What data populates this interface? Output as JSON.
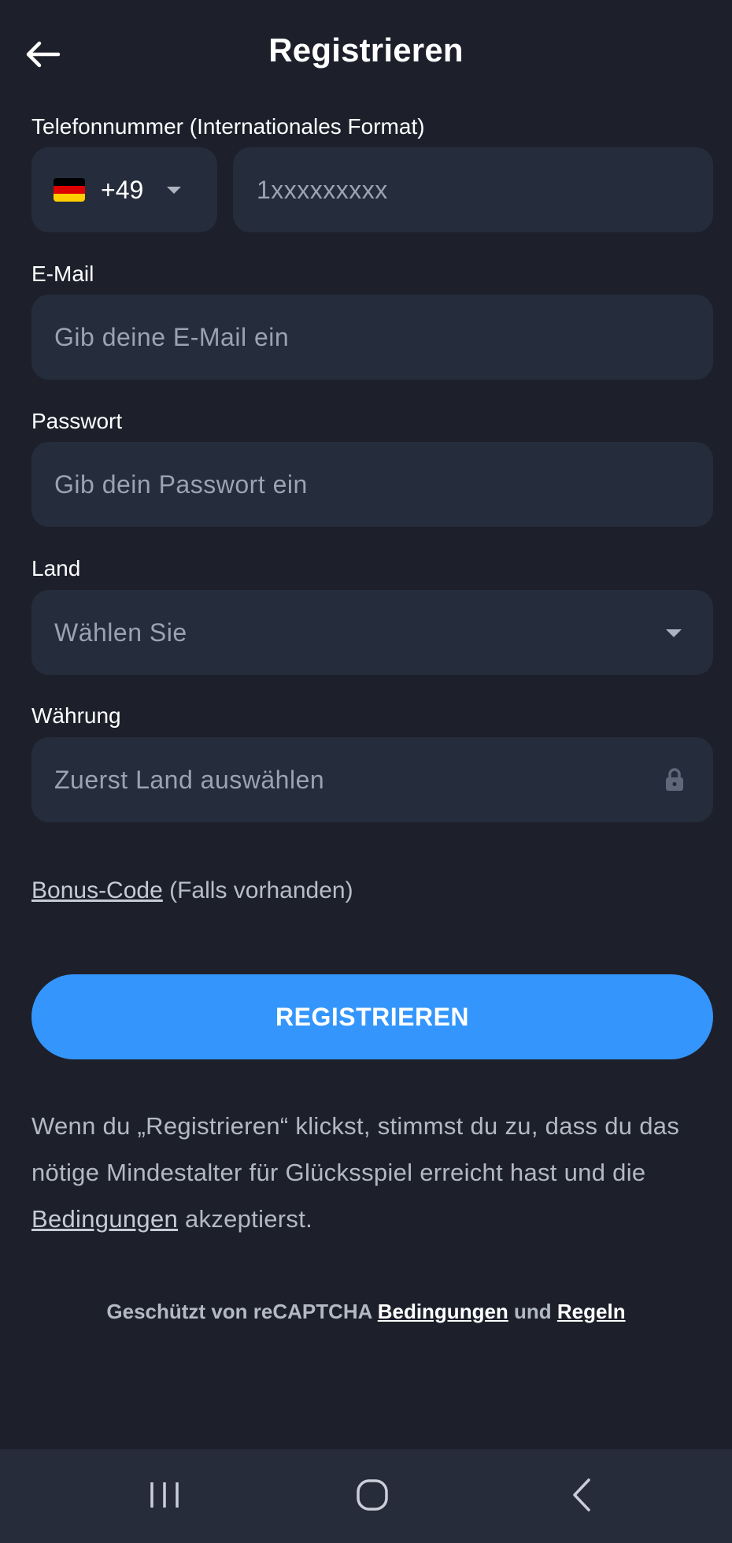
{
  "header": {
    "title": "Registrieren",
    "back_icon": "arrow-left-icon"
  },
  "phone": {
    "label": "Telefonnummer (Internationales Format)",
    "country_flag": "germany-flag-icon",
    "dial_code": "+49",
    "placeholder": "1xxxxxxxxx"
  },
  "email": {
    "label": "E-Mail",
    "placeholder": "Gib deine E-Mail ein"
  },
  "password": {
    "label": "Passwort",
    "placeholder": "Gib dein Passwort ein"
  },
  "country": {
    "label": "Land",
    "placeholder": "Wählen Sie"
  },
  "currency": {
    "label": "Währung",
    "placeholder": "Zuerst Land auswählen",
    "icon": "lock-icon"
  },
  "bonus": {
    "link_text": "Bonus-Code",
    "suffix": " (Falls vorhanden)"
  },
  "register_button": {
    "label": "REGISTRIEREN"
  },
  "terms": {
    "text_before": "Wenn du „Registrieren“ klickst, stimmst du zu, dass du das nötige Mindestalter für Glücksspiel erreicht hast und die ",
    "link_text": "Bedingungen",
    "text_after": " akzeptierst."
  },
  "recaptcha": {
    "prefix": "Geschützt von reCAPTCHA ",
    "terms_link": "Bedingungen",
    "middle": " und ",
    "rules_link": "Regeln"
  },
  "colors": {
    "background": "#1d202b",
    "field": "#252c3b",
    "accent": "#3496fc",
    "navbar": "#262c3a"
  },
  "navbar": {
    "recent_icon": "recent-apps-icon",
    "home_icon": "home-icon",
    "back_icon": "back-chevron-icon"
  }
}
